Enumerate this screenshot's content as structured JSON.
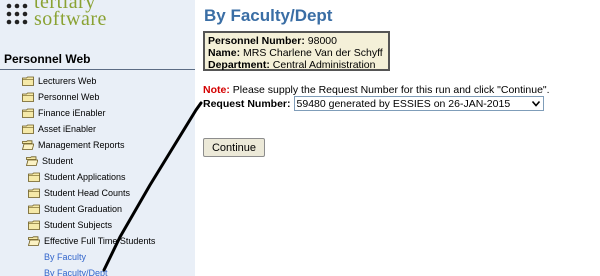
{
  "logo": {
    "line1": "tertiary",
    "line2": "software"
  },
  "sidebar": {
    "title": "Personnel Web",
    "items": [
      {
        "label": "Lecturers Web",
        "icon": "folder-closed"
      },
      {
        "label": "Personnel Web",
        "icon": "folder-closed"
      },
      {
        "label": "Finance iEnabler",
        "icon": "folder-closed"
      },
      {
        "label": "Asset iEnabler",
        "icon": "folder-closed"
      },
      {
        "label": "Management Reports",
        "icon": "folder-open"
      },
      {
        "label": "Student",
        "icon": "folder-open"
      },
      {
        "label": "Student Applications",
        "icon": "folder-closed"
      },
      {
        "label": "Student Head Counts",
        "icon": "folder-closed"
      },
      {
        "label": "Student Graduation",
        "icon": "folder-closed"
      },
      {
        "label": "Student Subjects",
        "icon": "folder-closed"
      },
      {
        "label": "Effective Full Time Students",
        "icon": "folder-open"
      },
      {
        "label": "By Faculty",
        "icon": "link"
      },
      {
        "label": "By Faculty/Dept",
        "icon": "link"
      }
    ]
  },
  "main": {
    "title": "By Faculty/Dept",
    "info": {
      "personnel_label": "Personnel Number:",
      "personnel_value": "98000",
      "name_label": "Name:",
      "name_value": "MRS Charlene Van der Schyff",
      "department_label": "Department:",
      "department_value": "Central Administration"
    },
    "note_label": "Note:",
    "note_text": "Please supply the Request Number for this run and click \"Continue\".",
    "request_label": "Request Number:",
    "request_value": "59480 generated by ESSIES on 26-JAN-2015",
    "continue_label": "Continue"
  },
  "colors": {
    "sidebar_bg": "#e9eff7",
    "title": "#3a6ea5",
    "note_label": "#d40000",
    "info_bg": "#f4f0d8",
    "link": "#3366cc",
    "logo": "#8aa233"
  }
}
